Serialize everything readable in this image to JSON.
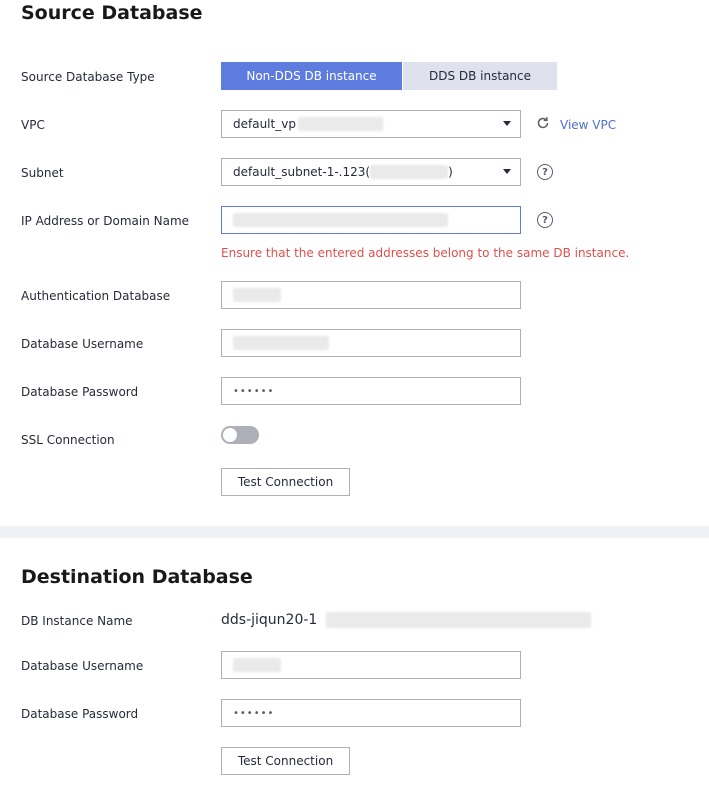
{
  "source": {
    "title": "Source Database",
    "type_label": "Source Database Type",
    "type_options": [
      "Non-DDS DB instance",
      "DDS DB instance"
    ],
    "vpc_label": "VPC",
    "vpc_value": "default_vp",
    "view_vpc": "View VPC",
    "subnet_label": "Subnet",
    "subnet_value": "default_subnet-1-.123(",
    "subnet_suffix": ")",
    "ip_label": "IP Address or Domain Name",
    "ip_error": "Ensure that the entered addresses belong to the same DB instance.",
    "auth_db_label": "Authentication Database",
    "username_label": "Database Username",
    "password_label": "Database Password",
    "password_value": "••••••",
    "ssl_label": "SSL Connection",
    "test_button": "Test Connection"
  },
  "destination": {
    "title": "Destination Database",
    "instance_label": "DB Instance Name",
    "instance_value": "dds-jiqun20-1",
    "username_label": "Database Username",
    "password_label": "Database Password",
    "password_value": "••••••",
    "test_button": "Test Connection"
  },
  "colors": {
    "accent": "#5e7ce0",
    "error": "#de504e",
    "link": "#526ecc"
  }
}
